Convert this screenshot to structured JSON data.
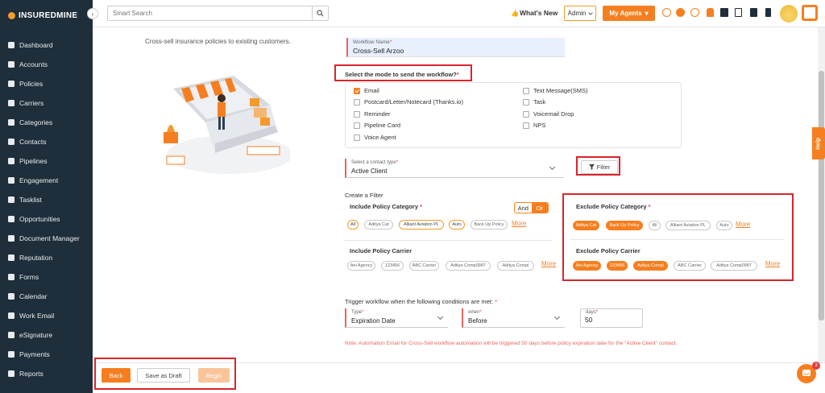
{
  "brand": {
    "name": "INSUREDMINE"
  },
  "sidebar": {
    "items": [
      {
        "label": "Dashboard"
      },
      {
        "label": "Accounts"
      },
      {
        "label": "Policies"
      },
      {
        "label": "Carriers"
      },
      {
        "label": "Categories"
      },
      {
        "label": "Contacts"
      },
      {
        "label": "Pipelines"
      },
      {
        "label": "Engagement"
      },
      {
        "label": "Tasklist"
      },
      {
        "label": "Opportunities"
      },
      {
        "label": "Document Manager"
      },
      {
        "label": "Reputation"
      },
      {
        "label": "Forms"
      },
      {
        "label": "Calendar"
      },
      {
        "label": "Work Email"
      },
      {
        "label": "eSignature"
      },
      {
        "label": "Payments"
      },
      {
        "label": "Reports"
      }
    ]
  },
  "topbar": {
    "search_placeholder": "Smart Search",
    "whats_new": "What's New",
    "admin_label": "Admin",
    "my_agents_label": "My Agents"
  },
  "help_tab": "Help",
  "main": {
    "subtitle": "Cross-sell insurance policies to existing customers.",
    "workflow_name": {
      "label": "Workflow Name",
      "value": "Cross-Sell Arzoo"
    },
    "mode_question": "Select the mode to send the workflow?",
    "modes": [
      {
        "label": "Email",
        "checked": true
      },
      {
        "label": "Postcard/Letter/Notecard (Thanks.io)",
        "checked": false
      },
      {
        "label": "Reminder",
        "checked": false
      },
      {
        "label": "Pipeline Card",
        "checked": false
      },
      {
        "label": "Voice Agent",
        "checked": false
      },
      {
        "label": "Text Message(SMS)",
        "checked": false
      },
      {
        "label": "Task",
        "checked": false
      },
      {
        "label": "Voicemail Drop",
        "checked": false
      },
      {
        "label": "NPS",
        "checked": false
      }
    ],
    "contact_type": {
      "label": "Select a contact type",
      "value": "Active Client"
    },
    "filter_button": "Filter",
    "create_filter": "Create a Filter",
    "include_category": {
      "title": "Include Policy Category",
      "and_label": "And",
      "or_label": "Or",
      "pills": [
        "All",
        "Aditya Cat",
        "Alliant Aviation PL",
        "Auto",
        "Back Up Policy"
      ],
      "more": "More"
    },
    "include_carrier": {
      "title": "Include Policy Carrier",
      "pills": [
        "Ani Agency",
        "123456",
        "ABC Carrier",
        "Aditya Comp0987",
        "Aditya Compl"
      ],
      "more": "More"
    },
    "exclude_category": {
      "title": "Exclude Policy Category",
      "pills": [
        "Aditya Cat",
        "Back Up Policy",
        "All",
        "Alliant Aviation PL",
        "Auto"
      ],
      "more": "More"
    },
    "exclude_carrier": {
      "title": "Exclude Policy Carrier",
      "pills": [
        "Ani Agency",
        "123456",
        "Aditya Compl",
        "ABC Carrier",
        "Aditya Comp0987"
      ],
      "more": "More"
    },
    "trigger_text": "Trigger workflow when the following conditions are met:",
    "type": {
      "label": "Type",
      "value": "Expiration Date"
    },
    "when": {
      "label": "when",
      "value": "Before"
    },
    "days": {
      "label": "days",
      "value": "50"
    },
    "note": "Note: Automation Email for Cross-Sell workflow automation will be triggered 50 days before policy expiration date for the \"Active Client\" contact."
  },
  "footer": {
    "back": "Back",
    "save_draft": "Save as Draft",
    "begin": "Begin"
  },
  "chat_badge": "3",
  "colors": {
    "accent": "#f57f20",
    "sidebar_bg": "#1e2e3a",
    "highlight_box": "#d9252b"
  }
}
